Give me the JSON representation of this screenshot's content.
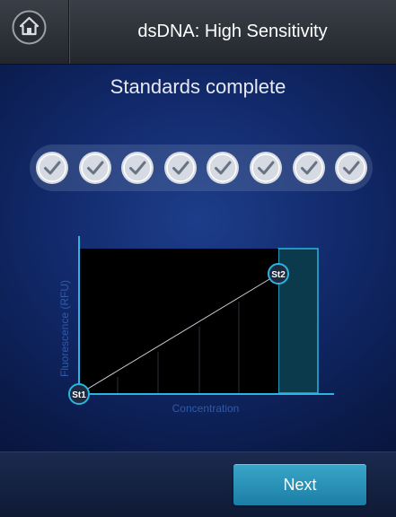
{
  "header": {
    "title": "dsDNA: High Sensitivity",
    "home_icon": "home-icon"
  },
  "main": {
    "status_text": "Standards complete",
    "standards": [
      {
        "status": "complete"
      },
      {
        "status": "complete"
      },
      {
        "status": "complete"
      },
      {
        "status": "complete"
      },
      {
        "status": "complete"
      },
      {
        "status": "complete"
      },
      {
        "status": "complete"
      },
      {
        "status": "complete"
      }
    ]
  },
  "chart_data": {
    "type": "line",
    "xlabel": "Concentration",
    "ylabel": "Fluorescence (RFU)",
    "points": [
      {
        "label": "St1",
        "x": 0,
        "y": 0
      },
      {
        "label": "St2",
        "x": 1,
        "y": 1
      }
    ],
    "grid": true
  },
  "footer": {
    "next_label": "Next"
  },
  "colors": {
    "accent": "#2bb4e0",
    "check": "#d6dae2",
    "button": "#2b93b8"
  }
}
